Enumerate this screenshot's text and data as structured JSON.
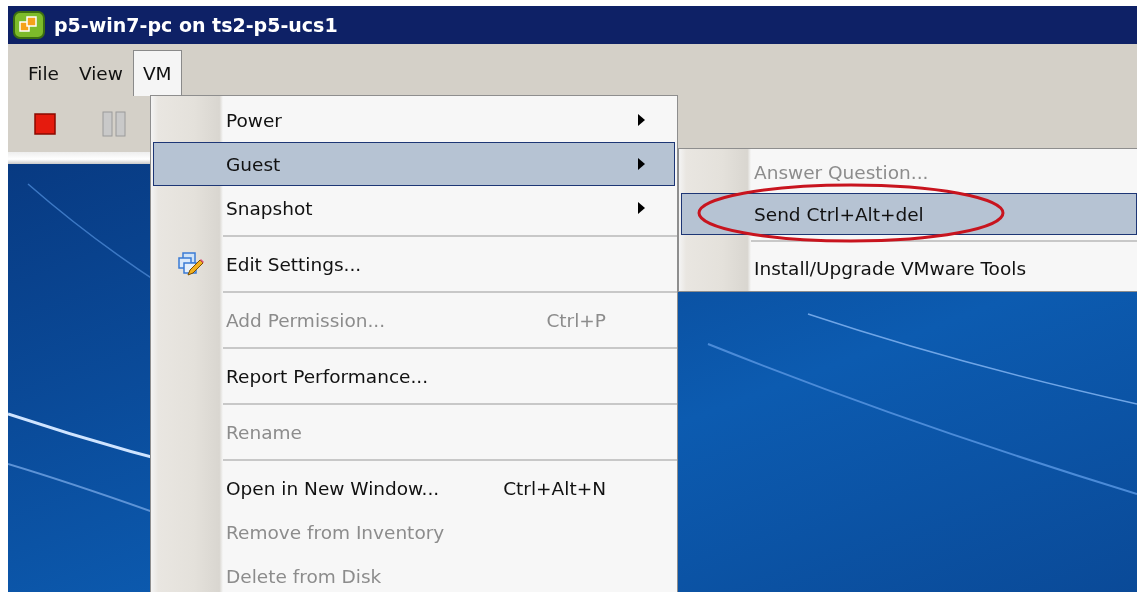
{
  "window": {
    "title": "p5-win7-pc on ts2-p5-ucs1"
  },
  "menu_bar": [
    {
      "label": "File",
      "selected": false
    },
    {
      "label": "View",
      "selected": false
    },
    {
      "label": "VM",
      "selected": true
    }
  ],
  "vm_menu": {
    "items": [
      {
        "kind": "item",
        "label": "Power",
        "submenu": true,
        "disabled": false,
        "selected": false
      },
      {
        "kind": "item",
        "label": "Guest",
        "submenu": true,
        "disabled": false,
        "selected": true
      },
      {
        "kind": "item",
        "label": "Snapshot",
        "submenu": true,
        "disabled": false,
        "selected": false
      },
      {
        "kind": "separator"
      },
      {
        "kind": "item",
        "label": "Edit Settings...",
        "icon": true,
        "submenu": false,
        "disabled": false,
        "selected": false
      },
      {
        "kind": "separator"
      },
      {
        "kind": "item",
        "label": "Add Permission...",
        "shortcut": "Ctrl+P",
        "submenu": false,
        "disabled": true,
        "selected": false
      },
      {
        "kind": "separator"
      },
      {
        "kind": "item",
        "label": "Report Performance...",
        "submenu": false,
        "disabled": false,
        "selected": false
      },
      {
        "kind": "separator"
      },
      {
        "kind": "item",
        "label": "Rename",
        "submenu": false,
        "disabled": true,
        "selected": false
      },
      {
        "kind": "separator"
      },
      {
        "kind": "item",
        "label": "Open in New Window...",
        "shortcut": "Ctrl+Alt+N",
        "submenu": false,
        "disabled": false,
        "selected": false
      },
      {
        "kind": "item",
        "label": "Remove from Inventory",
        "submenu": false,
        "disabled": true,
        "selected": false
      },
      {
        "kind": "item",
        "label": "Delete from Disk",
        "submenu": false,
        "disabled": true,
        "selected": false
      }
    ]
  },
  "guest_menu": {
    "items": [
      {
        "kind": "item",
        "label": "Answer Question...",
        "submenu": false,
        "disabled": true,
        "selected": false
      },
      {
        "kind": "item",
        "label": "Send Ctrl+Alt+del",
        "submenu": false,
        "disabled": false,
        "selected": true
      },
      {
        "kind": "separator"
      },
      {
        "kind": "item",
        "label": "Install/Upgrade VMware Tools",
        "submenu": false,
        "disabled": false,
        "selected": false
      }
    ]
  }
}
